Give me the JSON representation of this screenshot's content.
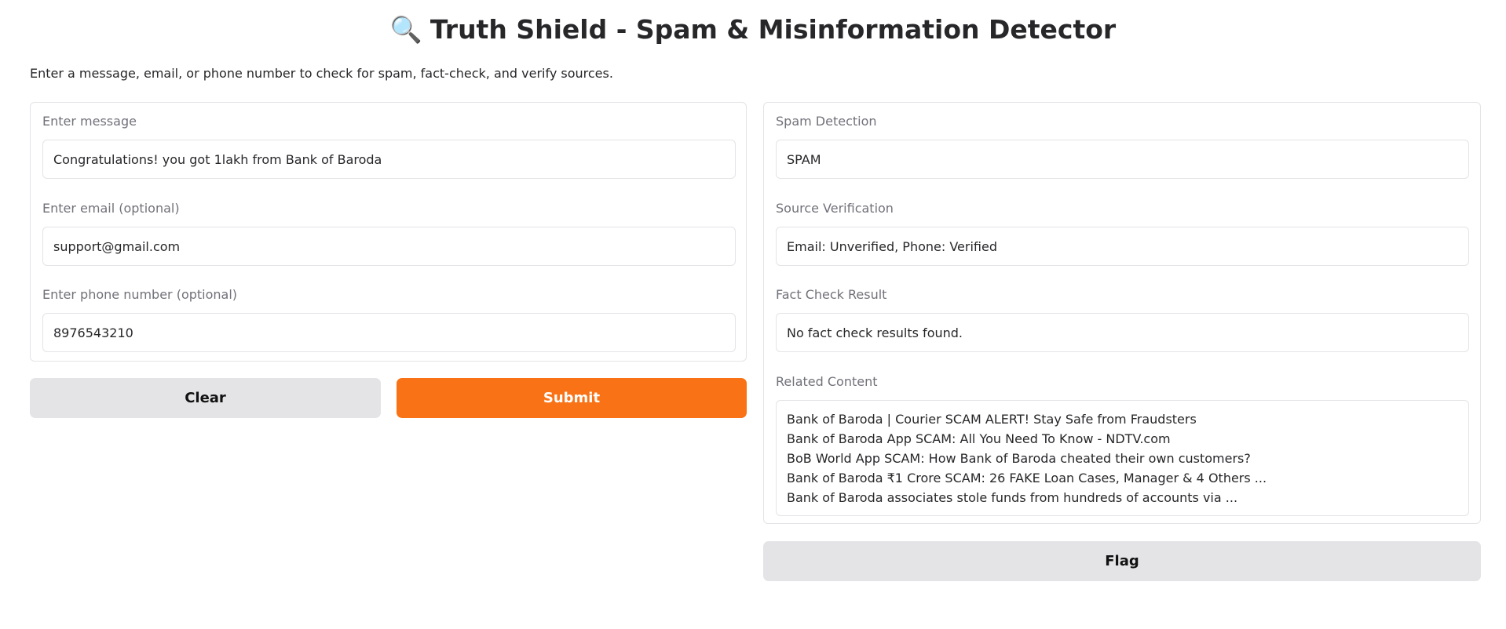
{
  "header": {
    "emoji": "🔍",
    "title": "Truth Shield - Spam & Misinformation Detector",
    "description": "Enter a message, email, or phone number to check for spam, fact-check, and verify sources."
  },
  "inputs": {
    "message": {
      "label": "Enter message",
      "value": "Congratulations! you got 1lakh from Bank of Baroda"
    },
    "email": {
      "label": "Enter email (optional)",
      "value": "support@gmail.com"
    },
    "phone": {
      "label": "Enter phone number (optional)",
      "value": "8976543210"
    }
  },
  "buttons": {
    "clear": "Clear",
    "submit": "Submit",
    "flag": "Flag"
  },
  "outputs": {
    "spam": {
      "label": "Spam Detection",
      "value": "SPAM"
    },
    "source": {
      "label": "Source Verification",
      "value": "Email: Unverified, Phone: Verified"
    },
    "fact_check": {
      "label": "Fact Check Result",
      "value": "No fact check results found."
    },
    "related": {
      "label": "Related Content",
      "lines": [
        "Bank of Baroda | Courier SCAM ALERT! Stay Safe from Fraudsters",
        "Bank of Baroda App SCAM: All You Need To Know - NDTV.com",
        "BoB World App SCAM: How Bank of Baroda cheated their own customers?",
        "Bank of Baroda ₹1 Crore SCAM: 26 FAKE Loan Cases, Manager & 4 Others ...",
        "Bank of Baroda associates stole funds from hundreds of accounts via ..."
      ]
    }
  },
  "colors": {
    "accent": "#f97316",
    "secondary_button": "#e4e4e7",
    "border": "#e4e4e7",
    "label": "#71717a",
    "text": "#27272a"
  }
}
